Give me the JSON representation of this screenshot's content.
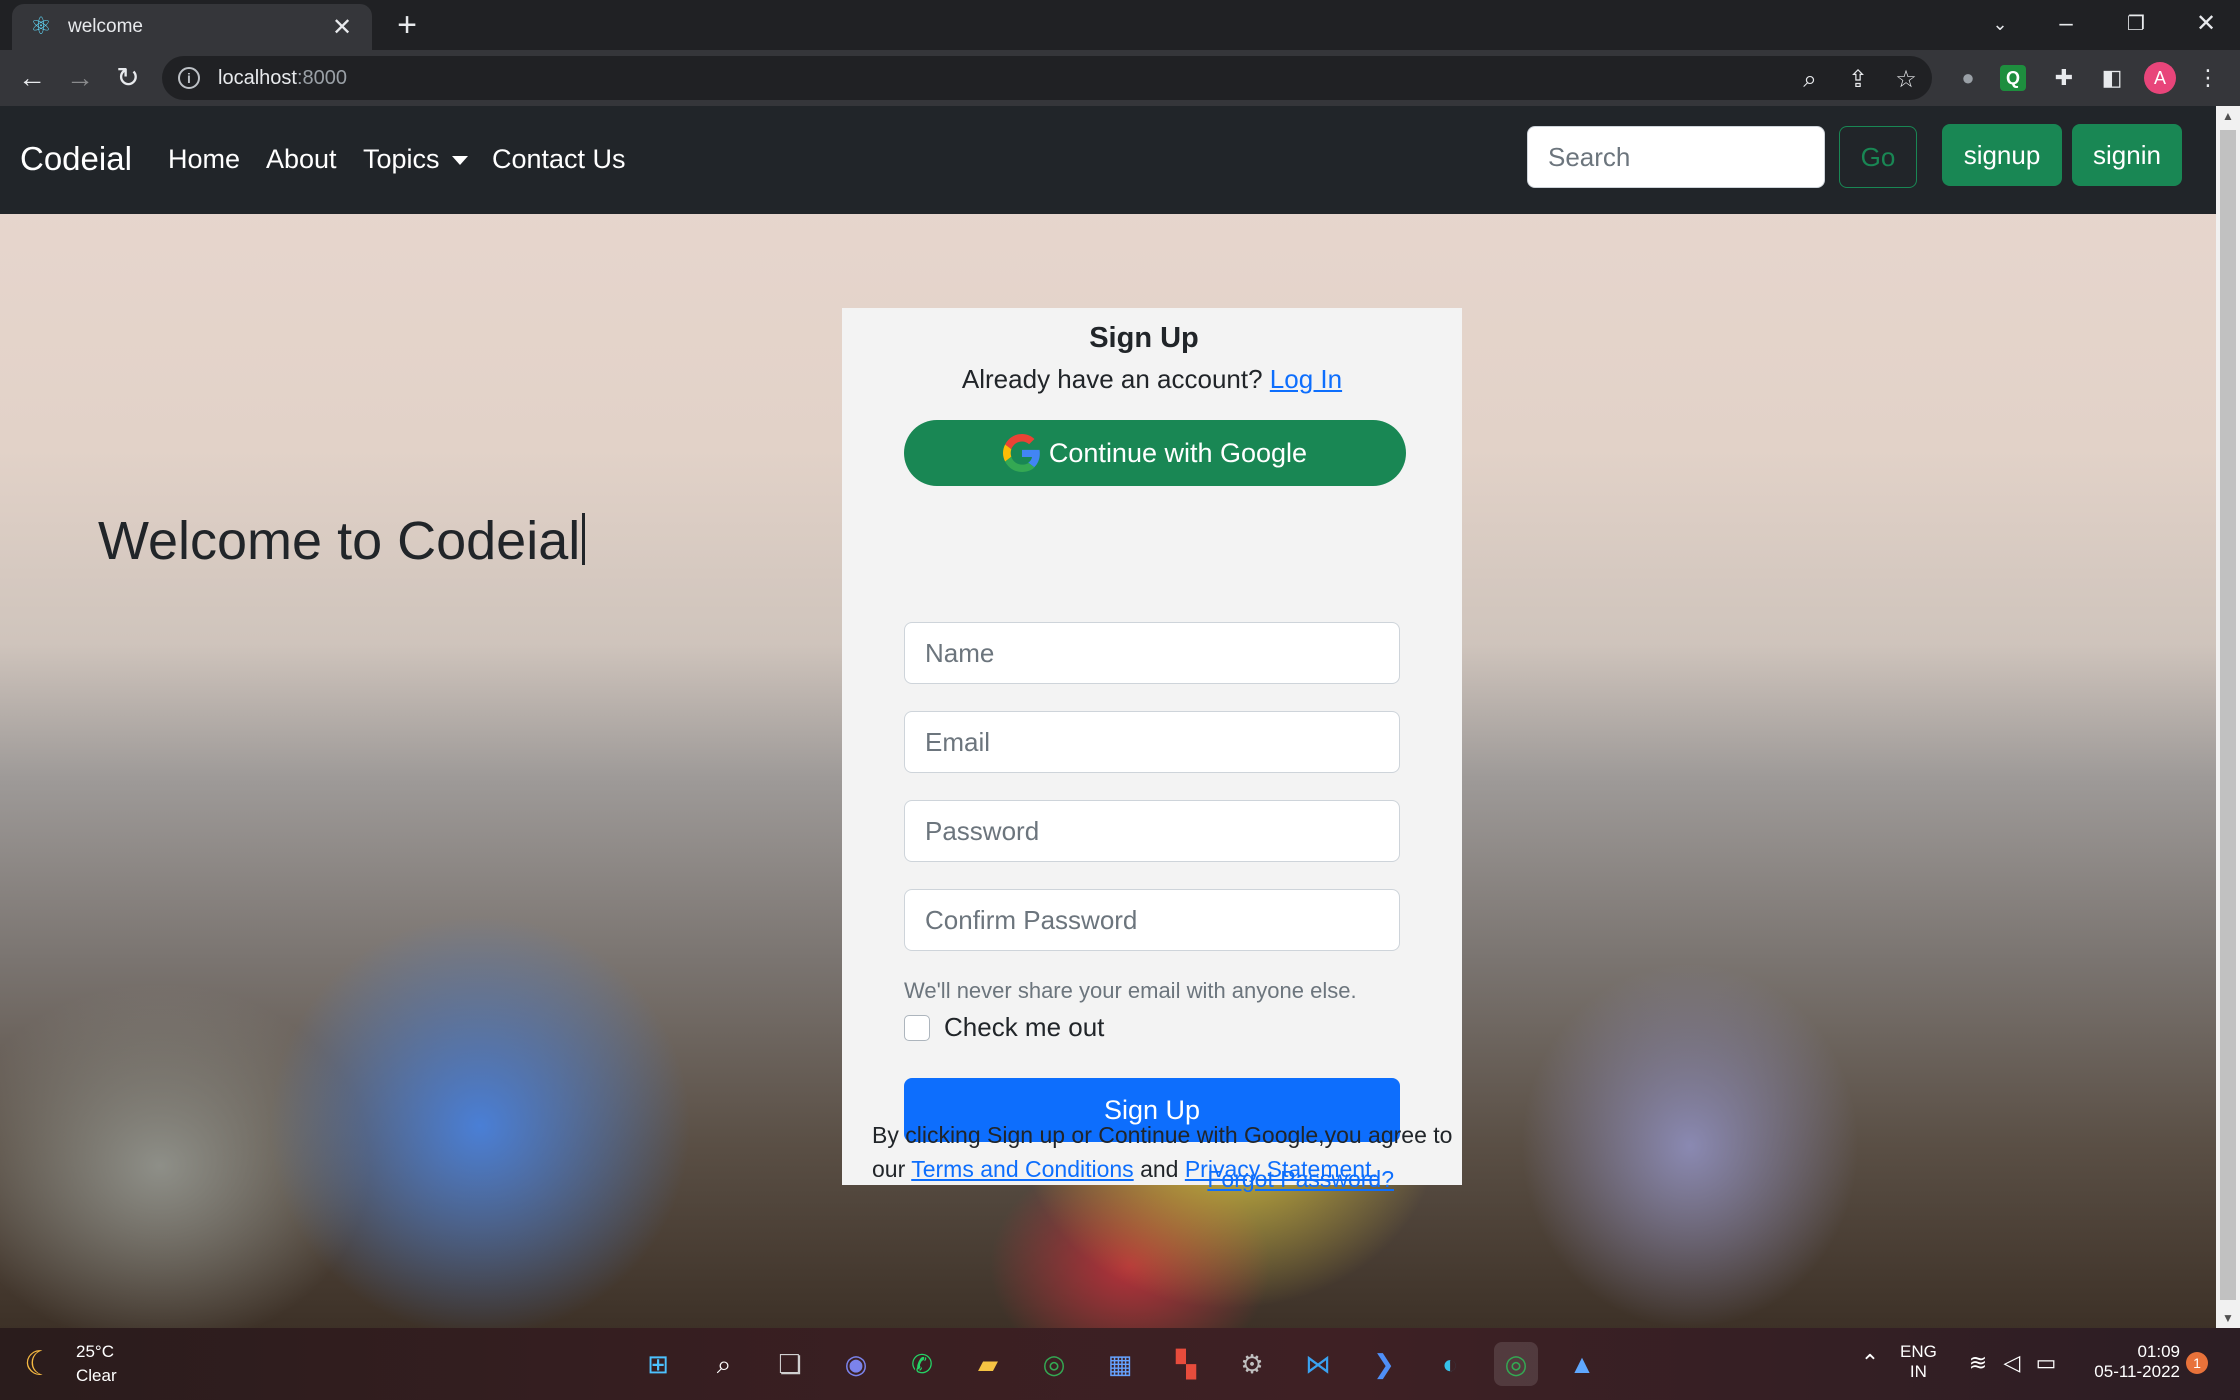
{
  "browser": {
    "tab_title": "welcome",
    "url_host": "localhost",
    "url_port": ":8000",
    "profile_initial": "A"
  },
  "navbar": {
    "brand": "Codeial",
    "links": [
      "Home",
      "About",
      "Topics",
      "Contact Us"
    ],
    "search_placeholder": "Search",
    "go_label": "Go",
    "signup_label": "signup",
    "signin_label": "signin"
  },
  "hero": {
    "welcome": "Welcome to Codeial"
  },
  "signup_card": {
    "title": "Sign Up",
    "already_text": "Already have an account?",
    "login_link": "Log In",
    "google_button": "Continue with Google",
    "name_placeholder": "Name",
    "email_placeholder": "Email",
    "password_placeholder": "Password",
    "confirm_placeholder": "Confirm Password",
    "help_text": "We'll never share your email with anyone else.",
    "check_label": "Check me out",
    "submit_label": "Sign Up",
    "forgot_link": "Forgot Password?",
    "terms_prefix": "By clicking Sign up or Continue with Google,you agree to our",
    "terms_link": "Terms and Conditions",
    "terms_and": "and",
    "privacy_link": "Privacy Statement."
  },
  "taskbar": {
    "temperature": "25°C",
    "condition": "Clear",
    "lang_top": "ENG",
    "lang_bottom": "IN",
    "time": "01:09",
    "date": "05-11-2022",
    "notification_count": "1"
  },
  "colors": {
    "navbar_bg": "#212529",
    "success": "#198754",
    "primary": "#0d6efd",
    "card_bg": "#f3f3f3"
  }
}
